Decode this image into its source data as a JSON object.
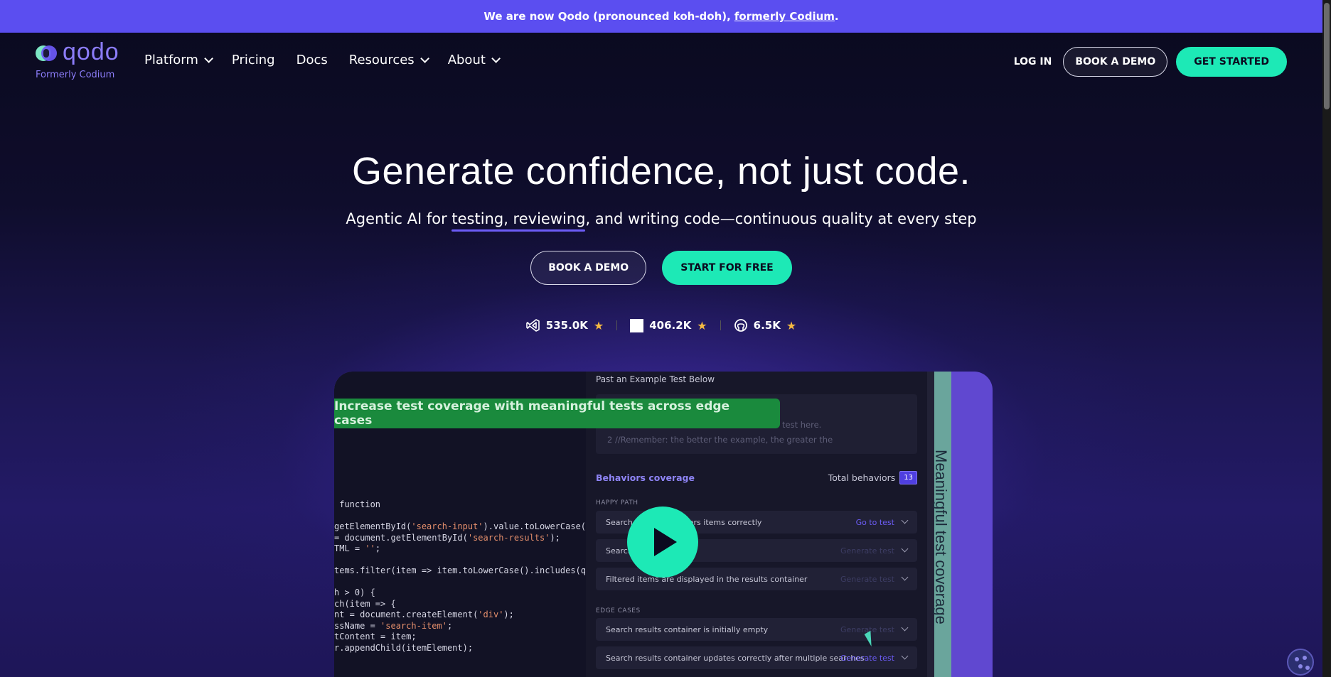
{
  "announcement": {
    "text": "We are now Qodo (pronounced koh-doh),",
    "link": "formerly Codium",
    "suffix": "."
  },
  "nav": {
    "logo_text": "qodo",
    "logo_subtitle": "Formerly Codium",
    "menu": [
      {
        "label": "Platform",
        "dropdown": true
      },
      {
        "label": "Pricing",
        "dropdown": false
      },
      {
        "label": "Docs",
        "dropdown": false
      },
      {
        "label": "Resources",
        "dropdown": true
      },
      {
        "label": "About",
        "dropdown": true
      }
    ],
    "login": "LOG IN",
    "book_demo": "BOOK A DEMO",
    "get_started": "GET STARTED"
  },
  "hero": {
    "title": "Generate confidence, not just code.",
    "subtitle_before": "Agentic AI for ",
    "subtitle_highlight": "testing, reviewing",
    "subtitle_after": ", and writing code—continuous quality at every step",
    "cta_demo": "BOOK A DEMO",
    "cta_free": "START FOR FREE"
  },
  "stats": [
    {
      "icon": "vscode-icon",
      "value": "535.0K"
    },
    {
      "icon": "jetbrains-icon",
      "value": "406.2K"
    },
    {
      "icon": "github-icon",
      "value": "6.5K"
    }
  ],
  "video": {
    "banner": "Increase test coverage with meaningful tests across edge cases",
    "code_lines": [
      " function",
      "",
      "getElementById('search-input').value.toLowerCase(",
      "= document.getElementById('search-results');",
      "TML = '';",
      "",
      "tems.filter(item => item.toLowerCase().includes(q",
      "",
      "h > 0) {",
      "ch(item => {",
      "nt = document.createElement('div');",
      "ssName = 'search-item';",
      "tContent = item;",
      "r.appendChild(itemElement);"
    ],
    "panel_header": "Past an Example Test Below",
    "editor_line1": "test here.",
    "editor_line2": "2  //Remember: the better the example, the greater the",
    "behaviors_title": "Behaviors coverage",
    "total_label": "Total behaviors",
    "total_count": "13",
    "happy_path_label": "HAPPY PATH",
    "edge_cases_label": "EDGE CASES",
    "happy_rows": [
      {
        "text": "Search                   ounce and filters items correctly",
        "action": "Go to test"
      },
      {
        "text": "Search",
        "action": "Generate test"
      },
      {
        "text": "Filtered items are displayed in the results container",
        "action": "Generate test"
      }
    ],
    "edge_rows": [
      {
        "text": "Search results container is initially empty",
        "action": "Generate test"
      },
      {
        "text": "Search results container updates correctly after multiple searches",
        "action": "Generate test"
      }
    ],
    "side_label": "Meaningful test coverage"
  },
  "colors": {
    "accent": "#1de9b6",
    "brand": "#5b4ef0"
  }
}
